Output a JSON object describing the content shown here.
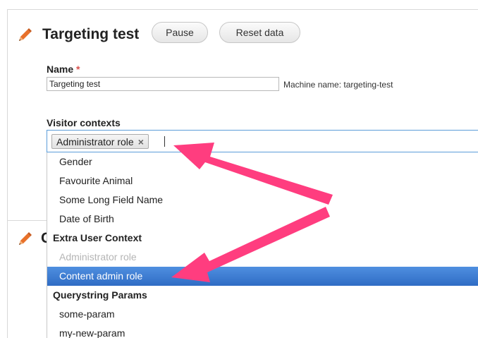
{
  "page": {
    "title": "Targeting test",
    "buttons": {
      "pause": "Pause",
      "reset": "Reset data"
    }
  },
  "name_field": {
    "label": "Name",
    "required_marker": "*",
    "value": "Targeting test",
    "machine_name": "Machine name: targeting-test"
  },
  "visitor_contexts": {
    "label": "Visitor contexts",
    "selected_token": "Administrator role",
    "token_remove": "×",
    "options": [
      {
        "label": "Gender",
        "type": "option"
      },
      {
        "label": "Favourite Animal",
        "type": "option"
      },
      {
        "label": "Some Long Field Name",
        "type": "option"
      },
      {
        "label": "Date of Birth",
        "type": "option"
      },
      {
        "label": "Extra User Context",
        "type": "group"
      },
      {
        "label": "Administrator role",
        "type": "disabled"
      },
      {
        "label": "Content admin role",
        "type": "highlighted"
      },
      {
        "label": "Querystring Params",
        "type": "group"
      },
      {
        "label": "some-param",
        "type": "option"
      },
      {
        "label": "my-new-param",
        "type": "option"
      }
    ]
  },
  "second_section": {
    "title_partial": "C"
  },
  "colors": {
    "accent": "#2f6cc4",
    "annotation_arrow": "#ff3d7f",
    "pencil": "#e8712a"
  },
  "icons": {
    "edit": "pencil-icon",
    "remove": "close-icon"
  }
}
